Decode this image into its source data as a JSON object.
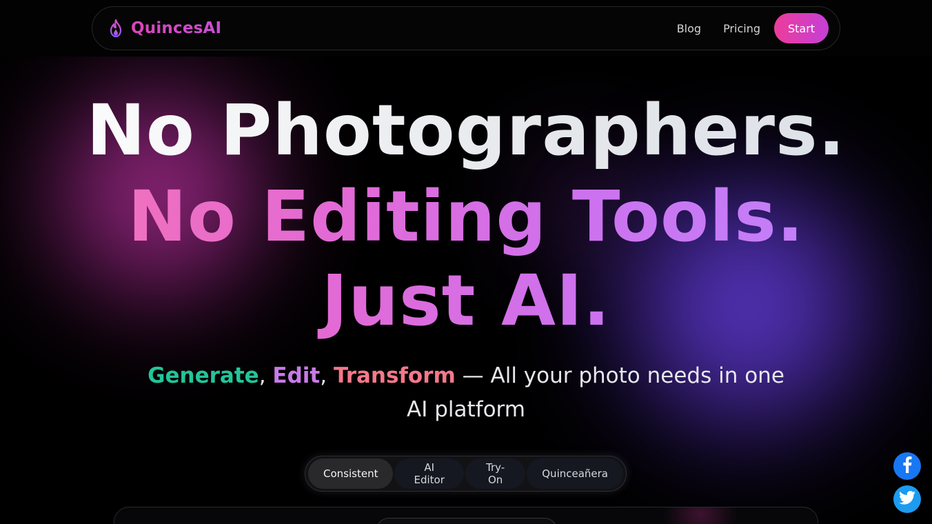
{
  "brand": {
    "name": "QuincesAI",
    "icon": "flame-icon",
    "color": "#d946b8"
  },
  "nav": {
    "links": [
      {
        "label": "Blog"
      },
      {
        "label": "Pricing"
      }
    ],
    "start_label": "Start",
    "start_color": "#e83fa6"
  },
  "hero": {
    "line1": "No Photographers.",
    "line2": "No Editing Tools. Just AI."
  },
  "subtitle": {
    "generate": "Generate",
    "sep1": ", ",
    "edit": "Edit",
    "sep2": ", ",
    "transform": "Transform",
    "rest": " — All your photo needs in one AI platform",
    "colors": {
      "generate": "#22c59a",
      "edit": "#c87ae6",
      "transform": "#f4788a"
    }
  },
  "tabs": [
    {
      "label": "Consistent",
      "active": true
    },
    {
      "label": "AI Editor",
      "active": false
    },
    {
      "label": "Try-On",
      "active": false
    },
    {
      "label": "Quinceañera",
      "active": false
    }
  ],
  "social": [
    {
      "icon": "facebook-icon",
      "color": "#1877f2"
    },
    {
      "icon": "twitter-icon",
      "color": "#1d9bf0"
    }
  ]
}
